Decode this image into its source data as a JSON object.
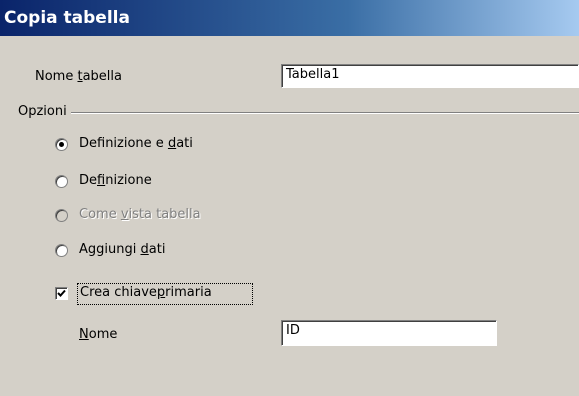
{
  "dialog": {
    "title": "Copia tabella"
  },
  "table_name": {
    "label_pre": "Nome ",
    "label_mn": "t",
    "label_post": "abella",
    "value": "Tabella1"
  },
  "options": {
    "group_label": "Opzioni",
    "radios": [
      {
        "pre": "Definizione e ",
        "mn": "d",
        "post": "ati",
        "checked": true,
        "enabled": true
      },
      {
        "pre": "De",
        "mn": "f",
        "post": "inizione",
        "checked": false,
        "enabled": true
      },
      {
        "pre": "Come ",
        "mn": "v",
        "post": "ista tabella",
        "checked": false,
        "enabled": false
      },
      {
        "pre": "Aggiungi ",
        "mn": "d",
        "post": "ati",
        "checked": false,
        "enabled": true
      }
    ],
    "primary_key": {
      "pre": "Crea chiave",
      "mn": "p",
      "post": "rimaria",
      "checked": true
    },
    "key_name": {
      "label_mn": "N",
      "label_post": "ome",
      "value": "ID"
    }
  }
}
